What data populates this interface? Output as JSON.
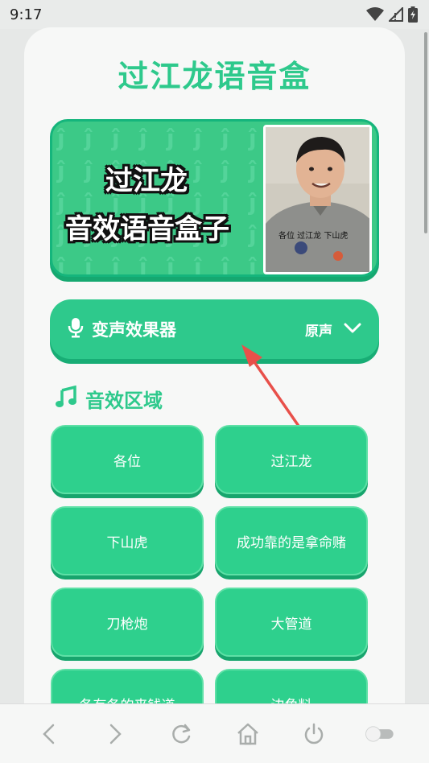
{
  "status_bar": {
    "time": "9:17",
    "icons": [
      "wifi-icon",
      "signal-icon",
      "battery-charging-icon"
    ]
  },
  "app": {
    "title": "过江龙语音盒"
  },
  "banner": {
    "line1": "过江龙",
    "line2": "音效语音盒子",
    "photo_caption": "各位 过江龙 下山虎"
  },
  "voice_changer": {
    "icon": "microphone-icon",
    "label": "变声效果器",
    "selected": "原声",
    "dropdown_icon": "chevron-down-icon"
  },
  "sounds_section": {
    "icon": "music-note-icon",
    "title": "音效区域",
    "buttons": [
      {
        "label": "各位"
      },
      {
        "label": "过江龙"
      },
      {
        "label": "下山虎"
      },
      {
        "label": "成功靠的是拿命赌"
      },
      {
        "label": "刀枪炮"
      },
      {
        "label": "大管道"
      },
      {
        "label": "各有各的来钱道"
      },
      {
        "label": "边角料"
      }
    ]
  },
  "bottom_nav": {
    "items": [
      "back-icon",
      "forward-icon",
      "reload-icon",
      "home-icon",
      "power-icon",
      "toggle-switch"
    ]
  },
  "colors": {
    "accent": "#2ec98c",
    "accent_dark": "#18ad75",
    "background": "#f7f8f7",
    "arrow": "#e8504a"
  }
}
